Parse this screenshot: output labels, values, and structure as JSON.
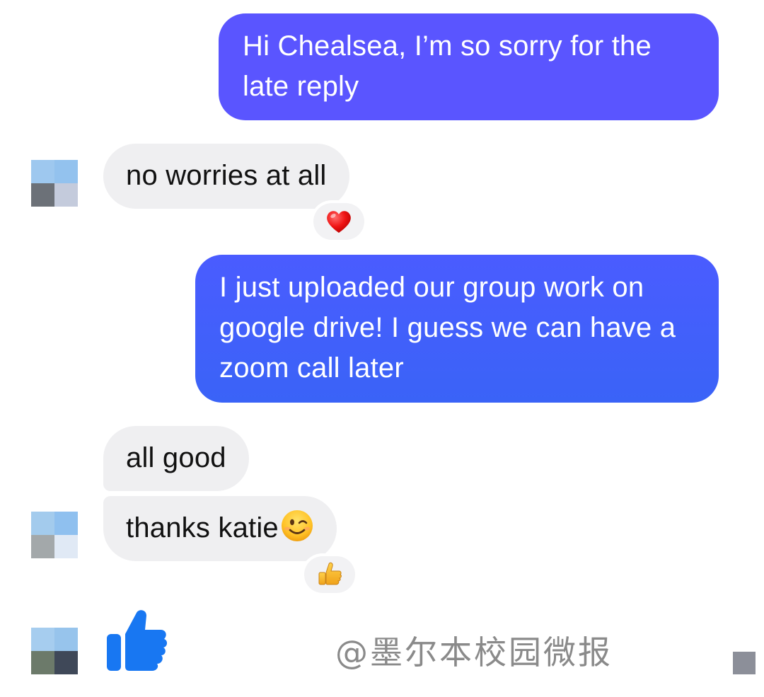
{
  "colors": {
    "outgoing_bubble_1": "#5a55ff",
    "outgoing_bubble_2": "#3f60fb",
    "incoming_bubble": "#efeff1",
    "like_blue": "#1877f2",
    "watermark_gray": "#8a8a8a"
  },
  "messages": [
    {
      "id": "msg1",
      "direction": "outgoing",
      "text": "Hi Chealsea, I’m so sorry for the late reply"
    },
    {
      "id": "msg2",
      "direction": "incoming",
      "text": "no worries at all",
      "reaction": "heart-emoji"
    },
    {
      "id": "msg3",
      "direction": "outgoing",
      "text": "I just uploaded our group work on google drive! I guess we can have a zoom call later"
    },
    {
      "id": "msg4",
      "direction": "incoming",
      "text": "all good"
    },
    {
      "id": "msg5",
      "direction": "incoming",
      "text": "thanks katie",
      "inline_emoji": "winking-face-emoji",
      "reaction": "thumbs-up-emoji"
    },
    {
      "id": "msg6",
      "direction": "outgoing",
      "type": "like-sticker",
      "icon": "thumbs-up-icon"
    }
  ],
  "avatars": [
    {
      "id": "avatar1",
      "pixels": [
        "#9ec8ef",
        "#93c2ee",
        "#6c7178",
        "#c4cbdc"
      ]
    },
    {
      "id": "avatar2",
      "pixels": [
        "#a3cbed",
        "#8fc0ef",
        "#a3a8aa",
        "#e0e9f5"
      ]
    },
    {
      "id": "avatar3",
      "pixels": [
        "#a6cdef",
        "#97c4ec",
        "#6c7a6a",
        "#3f4858"
      ]
    }
  ],
  "corner_pixel_color": "#8c8f99",
  "watermark": "@墨尔本校园微报"
}
